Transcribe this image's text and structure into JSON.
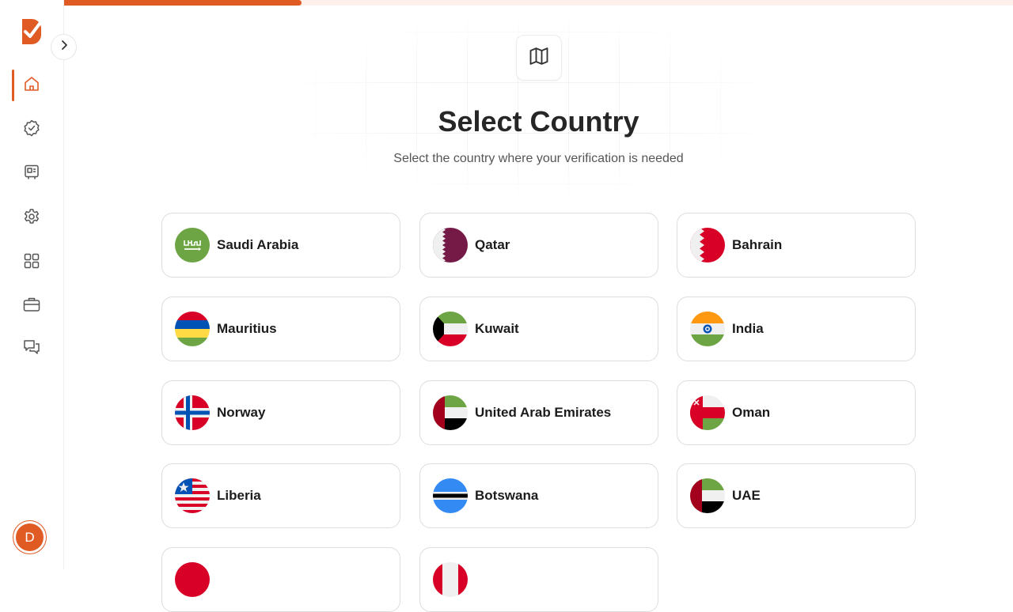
{
  "progress": {
    "value": 0.25
  },
  "sidebar": {
    "items": [
      {
        "icon": "home-icon",
        "active": true
      },
      {
        "icon": "verified-badge-icon",
        "active": false
      },
      {
        "icon": "id-card-icon",
        "active": false
      },
      {
        "icon": "gear-icon",
        "active": false
      },
      {
        "icon": "apps-grid-icon",
        "active": false
      },
      {
        "icon": "briefcase-icon",
        "active": false
      },
      {
        "icon": "chat-icon",
        "active": false
      }
    ],
    "user_initial": "D"
  },
  "header": {
    "title": "Select Country",
    "subtitle": "Select the country where your verification is needed"
  },
  "countries": [
    {
      "name": "Saudi Arabia",
      "flag": "saudi-arabia-flag-icon"
    },
    {
      "name": "Qatar",
      "flag": "qatar-flag-icon"
    },
    {
      "name": "Bahrain",
      "flag": "bahrain-flag-icon"
    },
    {
      "name": "Mauritius",
      "flag": "mauritius-flag-icon"
    },
    {
      "name": "Kuwait",
      "flag": "kuwait-flag-icon"
    },
    {
      "name": "India",
      "flag": "india-flag-icon"
    },
    {
      "name": "Norway",
      "flag": "norway-flag-icon"
    },
    {
      "name": "United Arab Emirates",
      "flag": "uae-flag-icon"
    },
    {
      "name": "Oman",
      "flag": "oman-flag-icon"
    },
    {
      "name": "Liberia",
      "flag": "liberia-flag-icon"
    },
    {
      "name": "Botswana",
      "flag": "botswana-flag-icon"
    },
    {
      "name": "UAE",
      "flag": "uae-flag-icon"
    },
    {
      "name": "",
      "flag": "partial-flag-icon"
    },
    {
      "name": "",
      "flag": "partial-flag-icon"
    }
  ],
  "colors": {
    "accent": "#e05a24"
  }
}
